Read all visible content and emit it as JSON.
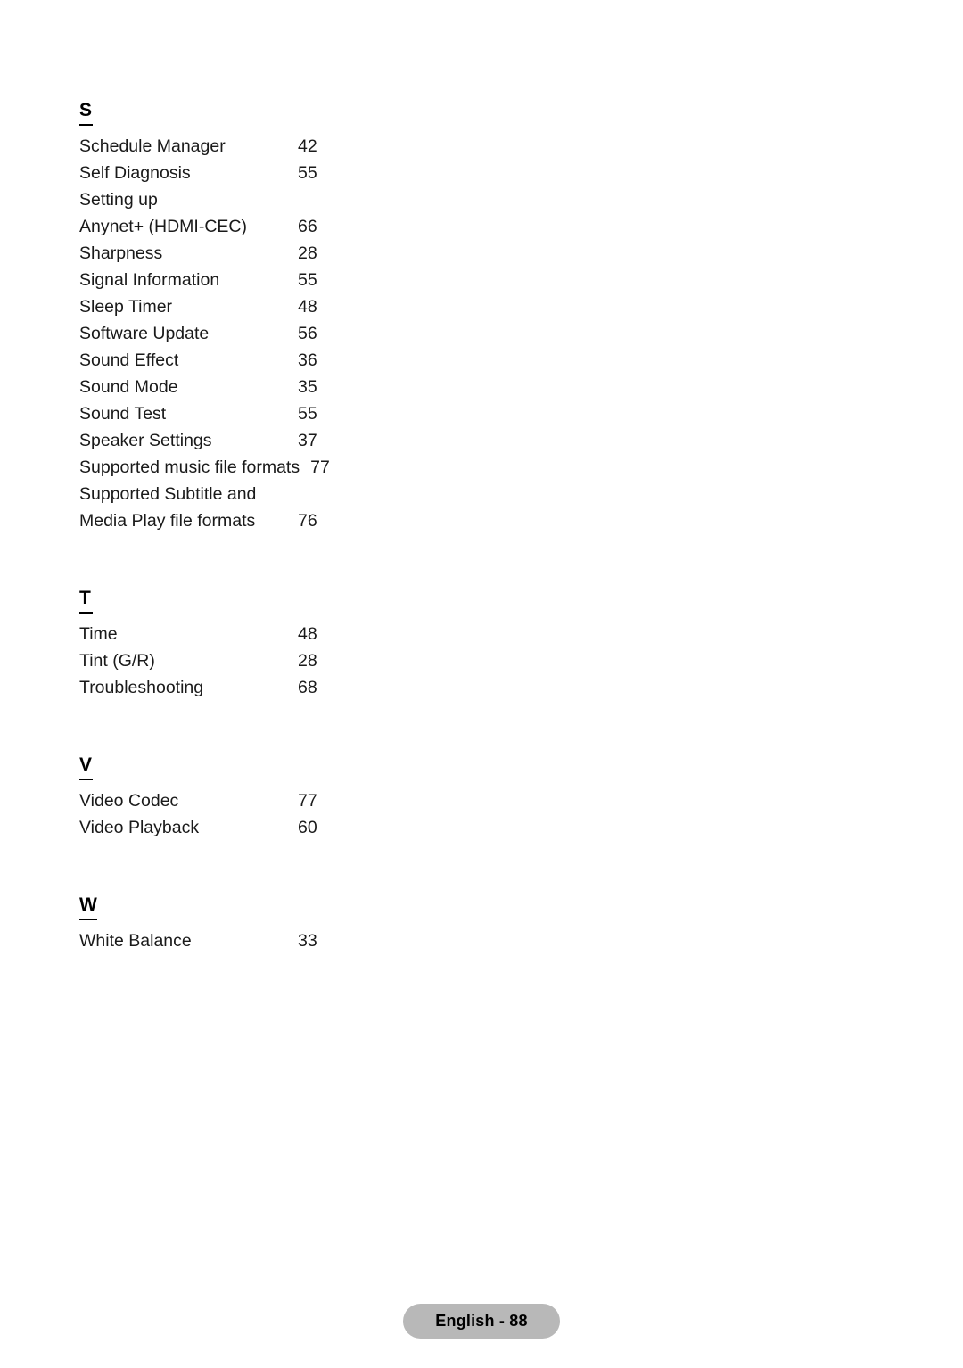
{
  "document": {
    "type": "index",
    "footer": {
      "label": "English - 88"
    }
  },
  "sections": [
    {
      "letter": "S",
      "entries": [
        {
          "title": "Schedule Manager",
          "page": "42"
        },
        {
          "title": "Self Diagnosis",
          "page": "55"
        },
        {
          "title": "Setting up",
          "continuation": "Anynet+ (HDMI-CEC)",
          "page": "66"
        },
        {
          "title": "Sharpness",
          "page": "28"
        },
        {
          "title": "Signal Information",
          "page": "55"
        },
        {
          "title": "Sleep Timer",
          "page": "48"
        },
        {
          "title": "Software Update",
          "page": "56"
        },
        {
          "title": "Sound Effect",
          "page": "36"
        },
        {
          "title": "Sound Mode",
          "page": "35"
        },
        {
          "title": "Sound Test",
          "page": "55"
        },
        {
          "title": "Speaker Settings",
          "page": "37"
        },
        {
          "title": "Supported music file formats",
          "page": "77",
          "wide": true
        },
        {
          "title": "Supported Subtitle and",
          "continuation": "Media Play file formats",
          "page": "76"
        }
      ]
    },
    {
      "letter": "T",
      "entries": [
        {
          "title": "Time",
          "page": "48"
        },
        {
          "title": "Tint (G/R)",
          "page": "28"
        },
        {
          "title": "Troubleshooting",
          "page": "68"
        }
      ]
    },
    {
      "letter": "V",
      "entries": [
        {
          "title": "Video Codec",
          "page": "77"
        },
        {
          "title": "Video Playback",
          "page": "60"
        }
      ]
    },
    {
      "letter": "W",
      "entries": [
        {
          "title": "White Balance",
          "page": "33"
        }
      ]
    }
  ]
}
